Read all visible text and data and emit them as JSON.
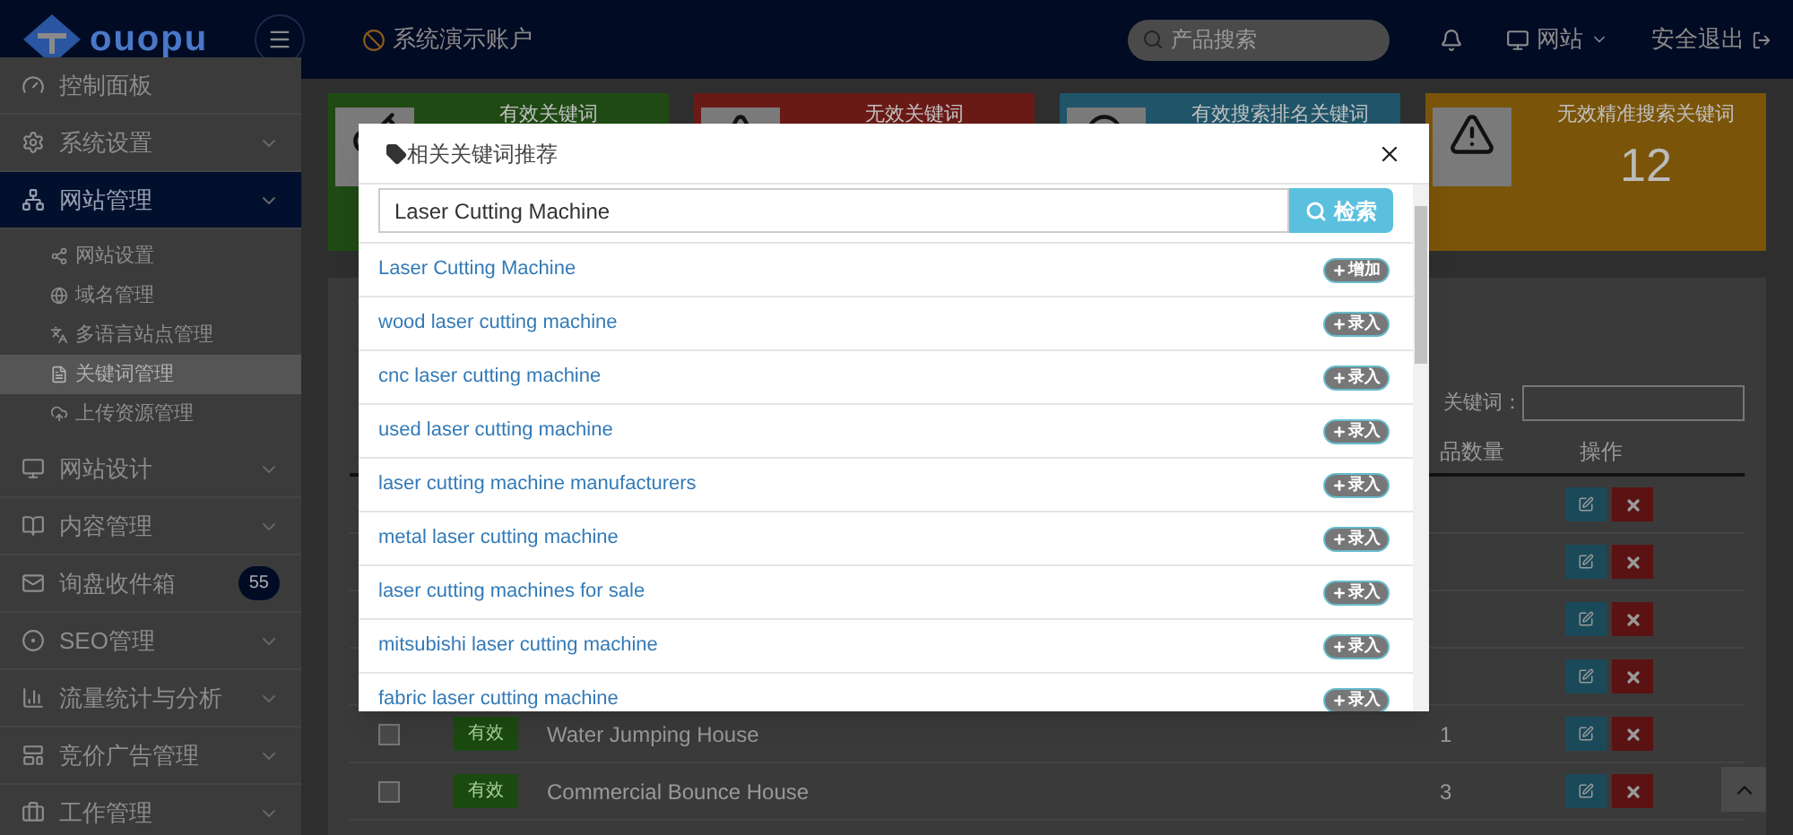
{
  "header": {
    "logo_text": "ouopu",
    "account": "系统演示账户",
    "search": {
      "placeholder": "产品搜索"
    },
    "site_menu": "网站",
    "logout": "安全退出"
  },
  "sidebar": {
    "items": [
      {
        "label": "控制面板",
        "kind": "plain",
        "selected": false
      },
      {
        "label": "系统设置",
        "kind": "group",
        "selected": false
      },
      {
        "label": "网站管理",
        "kind": "group",
        "selected": true,
        "children": [
          {
            "label": "网站设置",
            "selected": false
          },
          {
            "label": "域名管理",
            "selected": false
          },
          {
            "label": "多语言站点管理",
            "selected": false
          },
          {
            "label": "关键词管理",
            "selected": true
          },
          {
            "label": "上传资源管理",
            "selected": false
          }
        ]
      },
      {
        "label": "网站设计",
        "kind": "group",
        "selected": false
      },
      {
        "label": "内容管理",
        "kind": "group",
        "selected": false
      },
      {
        "label": "询盘收件箱",
        "kind": "badge",
        "badge": "55",
        "selected": false
      },
      {
        "label": "SEO管理",
        "kind": "group",
        "selected": false
      },
      {
        "label": "流量统计与分析",
        "kind": "group",
        "selected": false
      },
      {
        "label": "竞价广告管理",
        "kind": "group",
        "selected": false
      },
      {
        "label": "工作管理",
        "kind": "group",
        "selected": false
      }
    ]
  },
  "stats": [
    {
      "label": "有效关键词",
      "color": "#1f4a14"
    },
    {
      "label": "无效关键词",
      "color": "#6a1a16"
    },
    {
      "label": "有效搜索排名关键词",
      "color": "#1f5469"
    },
    {
      "label": "无效精准搜索关键词",
      "value": "12",
      "color": "#7a5408"
    }
  ],
  "table": {
    "filter_label": "关键词：",
    "columns": [
      "品数量",
      "操作"
    ],
    "rows": [
      {
        "kind": "hidden"
      },
      {
        "kind": "hidden"
      },
      {
        "kind": "hidden"
      },
      {
        "kind": "hidden"
      },
      {
        "kind": "full",
        "checked": false,
        "status": "有效",
        "name": "Water Jumping House",
        "count": "1"
      },
      {
        "kind": "full",
        "checked": false,
        "status": "有效",
        "name": "Commercial Bounce House",
        "count": "3"
      }
    ]
  },
  "modal": {
    "title": "相关关键词推荐",
    "search_value": "Laser Cutting Machine",
    "search_button": "检索",
    "results": [
      {
        "text": "Laser Cutting Machine",
        "action": "增加"
      },
      {
        "text": "wood laser cutting machine",
        "action": "录入"
      },
      {
        "text": "cnc laser cutting machine",
        "action": "录入"
      },
      {
        "text": "used laser cutting machine",
        "action": "录入"
      },
      {
        "text": "laser cutting machine manufacturers",
        "action": "录入"
      },
      {
        "text": "metal laser cutting machine",
        "action": "录入"
      },
      {
        "text": "laser cutting machines for sale",
        "action": "录入"
      },
      {
        "text": "mitsubishi laser cutting machine",
        "action": "录入"
      },
      {
        "text": "fabric laser cutting machine",
        "action": "录入"
      }
    ]
  }
}
